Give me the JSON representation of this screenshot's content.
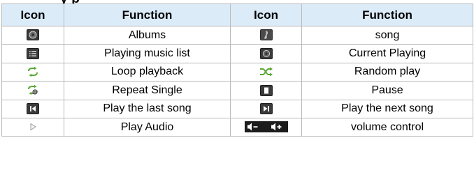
{
  "header_fragment": "y                    p",
  "headers": {
    "icon1": "Icon",
    "function1": "Function",
    "icon2": "Icon",
    "function2": "Function"
  },
  "rows": [
    {
      "left_icon": "album-icon",
      "left_function": "Albums",
      "right_icon": "song-icon",
      "right_function": "song"
    },
    {
      "left_icon": "playlist-icon",
      "left_function": "Playing music list",
      "right_icon": "current-playing-icon",
      "right_function": "Current Playing"
    },
    {
      "left_icon": "loop-icon",
      "left_function": "Loop playback",
      "right_icon": "shuffle-icon",
      "right_function": "Random play"
    },
    {
      "left_icon": "repeat-single-icon",
      "left_function": "Repeat Single",
      "right_icon": "pause-icon",
      "right_function": "Pause"
    },
    {
      "left_icon": "previous-icon",
      "left_function": "Play the last song",
      "right_icon": "next-icon",
      "right_function": "Play the next song"
    },
    {
      "left_icon": "play-icon",
      "left_function": "Play Audio",
      "right_icon": "volume-icon",
      "right_function": "volume control"
    }
  ],
  "colors": {
    "header_bg": "#dcebf8",
    "border": "#b9b9b9",
    "icon_dark": "#3a3a3a",
    "icon_green": "#5aa832"
  }
}
